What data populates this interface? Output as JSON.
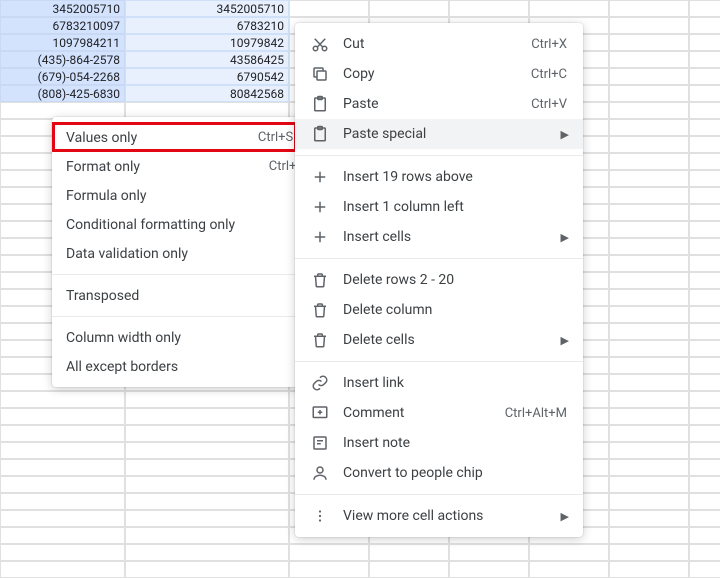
{
  "cells": {
    "colA": [
      "3452005710",
      "6783210097",
      "1097984211",
      "(435)-864-2578",
      "(679)-054-2268",
      "(808)-425-6830"
    ],
    "colB": [
      "3452005710",
      "6783210",
      "10979842",
      "43586425",
      "6790542",
      "80842568"
    ]
  },
  "context": {
    "cut": "Cut",
    "cut_sc": "Ctrl+X",
    "copy": "Copy",
    "copy_sc": "Ctrl+C",
    "paste": "Paste",
    "paste_sc": "Ctrl+V",
    "paste_special": "Paste special",
    "insert_rows": "Insert 19 rows above",
    "insert_col": "Insert 1 column left",
    "insert_cells": "Insert cells",
    "delete_rows": "Delete rows 2 - 20",
    "delete_col": "Delete column",
    "delete_cells": "Delete cells",
    "insert_link": "Insert link",
    "comment": "Comment",
    "comment_sc": "Ctrl+Alt+M",
    "insert_note": "Insert note",
    "people_chip": "Convert to people chip",
    "view_more": "View more cell actions"
  },
  "submenu": {
    "values_only": "Values only",
    "values_only_sc": "Ctrl+Shift+V",
    "format_only": "Format only",
    "format_only_sc": "Ctrl+Alt+V",
    "formula_only": "Formula only",
    "cond_fmt": "Conditional formatting only",
    "data_val": "Data validation only",
    "transposed": "Transposed",
    "col_width": "Column width only",
    "except_borders": "All except borders"
  }
}
